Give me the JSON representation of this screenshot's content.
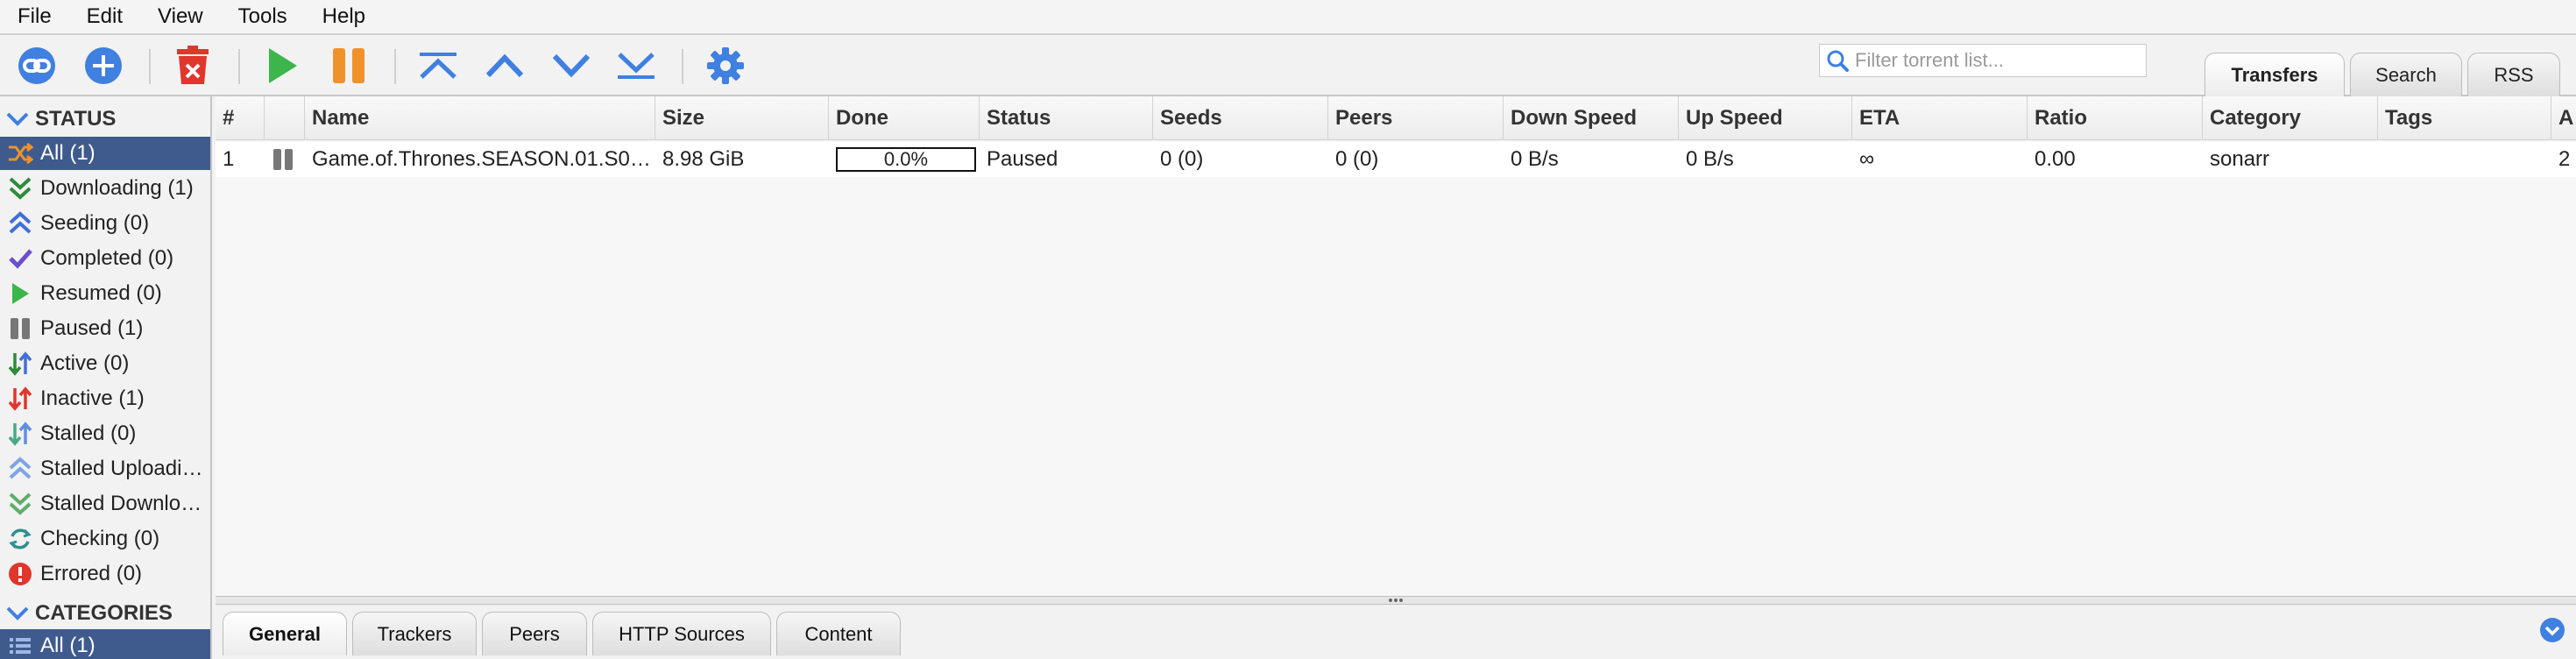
{
  "menu": [
    "File",
    "Edit",
    "View",
    "Tools",
    "Help"
  ],
  "toolbar": {
    "icons": [
      "add-link-icon",
      "add-torrent-icon",
      "delete-icon",
      "resume-icon",
      "pause-icon",
      "move-top-icon",
      "move-up-icon",
      "move-down-icon",
      "move-bottom-icon",
      "options-gear-icon"
    ],
    "filter_placeholder": "Filter torrent list...",
    "filter_value": "",
    "tabs": [
      "Transfers",
      "Search",
      "RSS"
    ],
    "active_tab": "Transfers"
  },
  "sidebar": {
    "status_header": "STATUS",
    "status_items": [
      {
        "label": "All (1)",
        "icon": "all-shuffle-icon",
        "selected": true
      },
      {
        "label": "Downloading (1)",
        "icon": "downloading-icon"
      },
      {
        "label": "Seeding (0)",
        "icon": "seeding-icon"
      },
      {
        "label": "Completed (0)",
        "icon": "completed-check-icon"
      },
      {
        "label": "Resumed (0)",
        "icon": "resumed-play-icon"
      },
      {
        "label": "Paused (1)",
        "icon": "paused-icon"
      },
      {
        "label": "Active (0)",
        "icon": "active-arrows-icon"
      },
      {
        "label": "Inactive (1)",
        "icon": "inactive-arrows-icon"
      },
      {
        "label": "Stalled (0)",
        "icon": "stalled-arrows-icon"
      },
      {
        "label": "Stalled Uploadi…",
        "icon": "stalled-uploading-icon"
      },
      {
        "label": "Stalled Downlo…",
        "icon": "stalled-downloading-icon"
      },
      {
        "label": "Checking (0)",
        "icon": "checking-refresh-icon"
      },
      {
        "label": "Errored (0)",
        "icon": "errored-icon"
      }
    ],
    "categories_header": "CATEGORIES",
    "category_items": [
      {
        "label": "All (1)",
        "icon": "category-list-icon",
        "selected": true
      }
    ]
  },
  "table": {
    "columns": [
      "#",
      "",
      "Name",
      "Size",
      "Done",
      "Status",
      "Seeds",
      "Peers",
      "Down Speed",
      "Up Speed",
      "ETA",
      "Ratio",
      "Category",
      "Tags",
      "A"
    ],
    "rows": [
      {
        "num": "1",
        "state_icon": "paused-icon",
        "name": "Game.of.Thrones.SEASON.01.S0…",
        "size": "8.98 GiB",
        "done": "0.0%",
        "done_fraction": 0.0,
        "status": "Paused",
        "seeds": "0 (0)",
        "peers": "0 (0)",
        "down_speed": "0 B/s",
        "up_speed": "0 B/s",
        "eta": "∞",
        "ratio": "0.00",
        "category": "sonarr",
        "tags": "",
        "extra": "2"
      }
    ]
  },
  "bottom_tabs": [
    "General",
    "Trackers",
    "Peers",
    "HTTP Sources",
    "Content"
  ],
  "bottom_active_tab": "General",
  "colors": {
    "accent_blue": "#3f80e0",
    "selection": "#3f5b8e",
    "delete_red": "#e0362c",
    "play_green": "#3cb54a",
    "pause_orange": "#f0922a"
  }
}
